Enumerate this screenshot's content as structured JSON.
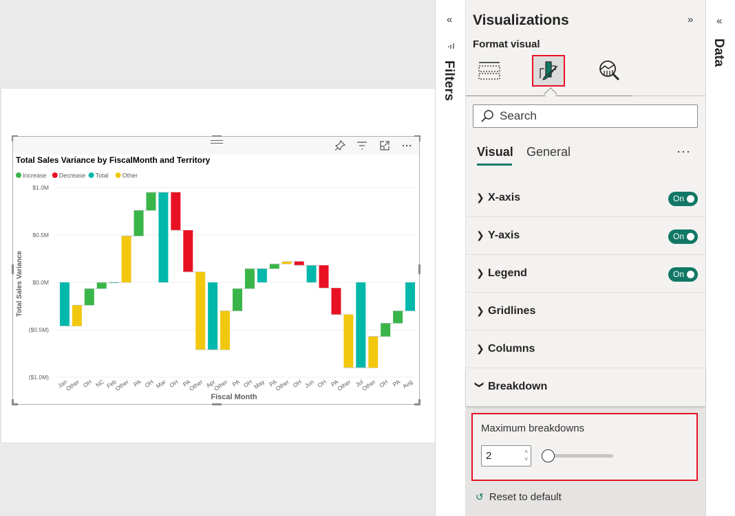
{
  "visual": {
    "title": "Total Sales Variance by FiscalMonth and Territory",
    "header_icons": [
      "pin-icon",
      "filter-icon",
      "focus-mode-icon",
      "more-options-icon"
    ]
  },
  "chart_data": {
    "type": "waterfall",
    "title": "Total Sales Variance by FiscalMonth and Territory",
    "xlabel": "Fiscal Month",
    "ylabel": "Total Sales Variance",
    "ylim": [
      -1.0,
      1.0
    ],
    "yunit": "$M",
    "yticks": [
      1.0,
      0.5,
      0.0,
      -0.5,
      -1.0
    ],
    "ytick_labels": [
      "$1.0M",
      "$0.5M",
      "$0.0M",
      "($0.5M)",
      "($1.0M)"
    ],
    "grid": true,
    "legend": {
      "placement": "top-left",
      "entries": [
        {
          "name": "Increase",
          "color": "#3ab54a"
        },
        {
          "name": "Decrease",
          "color": "#e81123"
        },
        {
          "name": "Total",
          "color": "#01b8aa"
        },
        {
          "name": "Other",
          "color": "#f2c80f"
        }
      ]
    },
    "categories": [
      "Jan",
      "Other",
      "OH",
      "NC",
      "Feb",
      "Other",
      "PA",
      "OH",
      "Mar",
      "OH",
      "PA",
      "Other",
      "Apr",
      "Other",
      "PA",
      "OH",
      "May",
      "PA",
      "Other",
      "OH",
      "Jun",
      "OH",
      "PA",
      "Other",
      "Jul",
      "Other",
      "OH",
      "PA",
      "Aug"
    ],
    "bars": [
      {
        "kind": "Total",
        "start": 0.0,
        "end": -0.46
      },
      {
        "kind": "Other",
        "start": -0.46,
        "end": -0.24
      },
      {
        "kind": "Increase",
        "start": -0.24,
        "end": -0.065
      },
      {
        "kind": "Increase",
        "start": -0.065,
        "end": 0.0
      },
      {
        "kind": "Total",
        "start": 0.0,
        "end": 0.0
      },
      {
        "kind": "Other",
        "start": 0.0,
        "end": 0.49
      },
      {
        "kind": "Increase",
        "start": 0.49,
        "end": 0.76
      },
      {
        "kind": "Increase",
        "start": 0.76,
        "end": 0.95
      },
      {
        "kind": "Total",
        "start": 0.0,
        "end": 0.95
      },
      {
        "kind": "Decrease",
        "start": 0.95,
        "end": 0.55
      },
      {
        "kind": "Decrease",
        "start": 0.55,
        "end": 0.11
      },
      {
        "kind": "Other",
        "start": 0.11,
        "end": -0.71
      },
      {
        "kind": "Total",
        "start": 0.0,
        "end": -0.71
      },
      {
        "kind": "Other",
        "start": -0.71,
        "end": -0.3
      },
      {
        "kind": "Increase",
        "start": -0.3,
        "end": -0.065
      },
      {
        "kind": "Increase",
        "start": -0.065,
        "end": 0.145
      },
      {
        "kind": "Total",
        "start": 0.0,
        "end": 0.145
      },
      {
        "kind": "Increase",
        "start": 0.145,
        "end": 0.195
      },
      {
        "kind": "Other",
        "start": 0.195,
        "end": 0.22
      },
      {
        "kind": "Decrease",
        "start": 0.22,
        "end": 0.18
      },
      {
        "kind": "Total",
        "start": 0.0,
        "end": 0.18
      },
      {
        "kind": "Decrease",
        "start": 0.18,
        "end": -0.06
      },
      {
        "kind": "Decrease",
        "start": -0.06,
        "end": -0.34
      },
      {
        "kind": "Other",
        "start": -0.34,
        "end": -0.9
      },
      {
        "kind": "Total",
        "start": 0.0,
        "end": -0.9
      },
      {
        "kind": "Other",
        "start": -0.9,
        "end": -0.57
      },
      {
        "kind": "Increase",
        "start": -0.57,
        "end": -0.43
      },
      {
        "kind": "Increase",
        "start": -0.43,
        "end": -0.3
      },
      {
        "kind": "Total",
        "start": 0.0,
        "end": -0.3
      }
    ]
  },
  "filters_pane": {
    "label": "Filters",
    "collapse_glyph": "«"
  },
  "visualizations_pane": {
    "title": "Visualizations",
    "expand_glyph": "»",
    "subtitle": "Format visual",
    "tabs": [
      {
        "name": "build-visual",
        "active": false
      },
      {
        "name": "format-visual",
        "active": true
      },
      {
        "name": "analytics",
        "active": false
      }
    ],
    "search_placeholder": "Search",
    "format_tabs": {
      "visual": "Visual",
      "general": "General",
      "more": "···"
    },
    "sections": [
      {
        "title": "X-axis",
        "toggle": "On",
        "expanded": false
      },
      {
        "title": "Y-axis",
        "toggle": "On",
        "expanded": false
      },
      {
        "title": "Legend",
        "toggle": "On",
        "expanded": false
      },
      {
        "title": "Gridlines",
        "toggle": null,
        "expanded": false
      },
      {
        "title": "Columns",
        "toggle": null,
        "expanded": false
      },
      {
        "title": "Breakdown",
        "toggle": null,
        "expanded": true
      }
    ],
    "breakdown": {
      "max_label": "Maximum breakdowns",
      "max_value": "2",
      "slider_fraction": 0.0,
      "reset_label": "Reset to default"
    },
    "accent_color": "#117865",
    "highlight_color": "#e81123"
  },
  "data_pane": {
    "label": "Data",
    "collapse_glyph": "«"
  }
}
